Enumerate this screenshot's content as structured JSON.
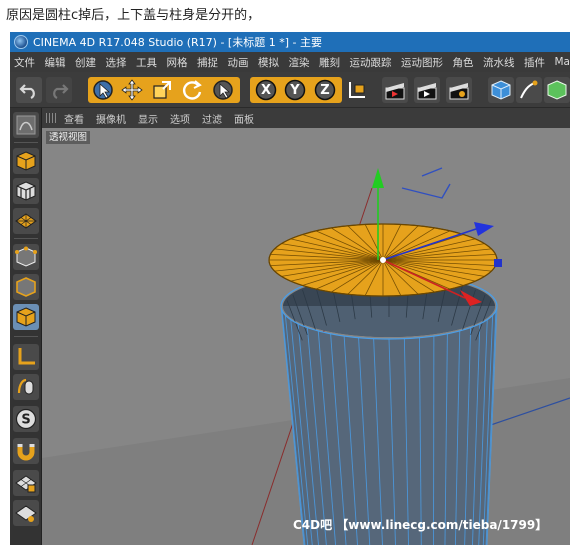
{
  "post": {
    "caption": "原因是圆柱c掉后，上下盖与柱身是分开的，"
  },
  "window": {
    "title": "CINEMA 4D R17.048 Studio (R17) - [未标题 1 *] - 主要"
  },
  "menu": [
    "文件",
    "编辑",
    "创建",
    "选择",
    "工具",
    "网格",
    "捕捉",
    "动画",
    "模拟",
    "渲染",
    "雕刻",
    "运动跟踪",
    "运动图形",
    "角色",
    "流水线",
    "插件",
    "Ma"
  ],
  "toolbar": {
    "axis_x": "X",
    "axis_y": "Y",
    "axis_z": "Z"
  },
  "viewport_menu": [
    "查看",
    "摄像机",
    "显示",
    "选项",
    "过滤",
    "面板"
  ],
  "viewport": {
    "label": "透视视图",
    "watermark": "C4D吧 【www.linecg.com/tieba/1799】"
  },
  "colors": {
    "titlebar": "#1f6fb8",
    "accent": "#e6a21c",
    "cap_fill": "#e6a21c",
    "cylinder": "#56677a",
    "wire": "#4a9ee8",
    "viewport_bg": "#868686"
  }
}
